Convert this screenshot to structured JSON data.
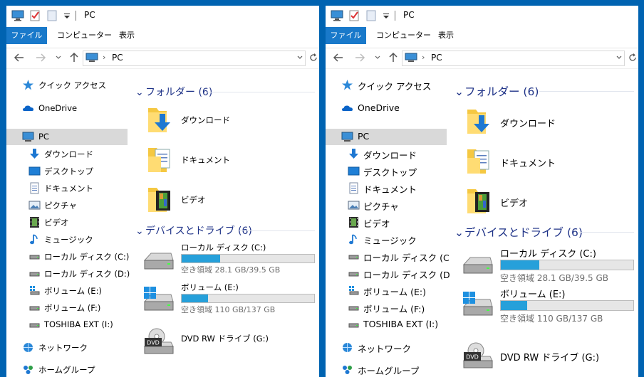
{
  "windows": [
    {
      "title": "PC",
      "ribbon": {
        "file_tab": "ファイル",
        "tabs": [
          "コンピューター",
          "表示"
        ]
      },
      "address": {
        "location": "PC"
      },
      "sidebar": {
        "items": [
          {
            "label": "クイック アクセス",
            "icon": "quick-access-star-icon",
            "level": 1
          },
          {
            "label": "OneDrive",
            "icon": "onedrive-cloud-icon",
            "level": 1
          },
          {
            "label": "PC",
            "icon": "pc-monitor-icon",
            "level": 1,
            "selected": true
          },
          {
            "label": "ダウンロード",
            "icon": "download-arrow-icon",
            "level": 2
          },
          {
            "label": "デスクトップ",
            "icon": "desktop-icon",
            "level": 2
          },
          {
            "label": "ドキュメント",
            "icon": "document-icon",
            "level": 2
          },
          {
            "label": "ピクチャ",
            "icon": "picture-icon",
            "level": 2
          },
          {
            "label": "ビデオ",
            "icon": "video-icon",
            "level": 2
          },
          {
            "label": "ミュージック",
            "icon": "music-note-icon",
            "level": 2
          },
          {
            "label": "ローカル ディスク (C:)",
            "icon": "drive-icon",
            "level": 2
          },
          {
            "label": "ローカル ディスク (D:)",
            "icon": "drive-icon",
            "level": 2
          },
          {
            "label": "ボリューム (E:)",
            "icon": "windows-drive-icon",
            "level": 2
          },
          {
            "label": "ボリューム (F:)",
            "icon": "drive-icon",
            "level": 2
          },
          {
            "label": "TOSHIBA EXT (I:)",
            "icon": "drive-icon",
            "level": 2
          },
          {
            "label": "ネットワーク",
            "icon": "network-icon",
            "level": 1
          },
          {
            "label": "ホームグループ",
            "icon": "homegroup-icon",
            "level": 1
          }
        ]
      },
      "content": {
        "folders_header": "フォルダー (6)",
        "folders": [
          {
            "label": "ダウンロード",
            "icon": "download-folder-icon"
          },
          {
            "label": "ドキュメント",
            "icon": "documents-folder-icon"
          },
          {
            "label": "ビデオ",
            "icon": "video-folder-icon"
          }
        ],
        "devices_header": "デバイスとドライブ (6)",
        "drives": [
          {
            "name": "ローカル ディスク (C:)",
            "space": "空き領域 28.1 GB/39.5 GB",
            "used_fraction": 0.29,
            "icon": "hard-drive-icon"
          },
          {
            "name": "ボリューム (E:)",
            "space": "空き領域 110 GB/137 GB",
            "used_fraction": 0.2,
            "icon": "windows-hard-drive-icon"
          },
          {
            "name": "DVD RW ドライブ (G:)",
            "icon": "dvd-drive-icon"
          }
        ]
      }
    },
    {
      "title": "PC",
      "ribbon": {
        "file_tab": "ファイル",
        "tabs": [
          "コンピューター",
          "表示"
        ]
      },
      "address": {
        "location": "PC"
      },
      "sidebar": {
        "items": [
          {
            "label": "クイック アクセス",
            "icon": "quick-access-star-icon",
            "level": 1
          },
          {
            "label": "OneDrive",
            "icon": "onedrive-cloud-icon",
            "level": 1
          },
          {
            "label": "PC",
            "icon": "pc-monitor-icon",
            "level": 1,
            "selected": true
          },
          {
            "label": "ダウンロード",
            "icon": "download-arrow-icon",
            "level": 2
          },
          {
            "label": "デスクトップ",
            "icon": "desktop-icon",
            "level": 2
          },
          {
            "label": "ドキュメント",
            "icon": "document-icon",
            "level": 2
          },
          {
            "label": "ピクチャ",
            "icon": "picture-icon",
            "level": 2
          },
          {
            "label": "ビデオ",
            "icon": "video-icon",
            "level": 2
          },
          {
            "label": "ミュージック",
            "icon": "music-note-icon",
            "level": 2
          },
          {
            "label": "ローカル ディスク (C",
            "icon": "drive-icon",
            "level": 2
          },
          {
            "label": "ローカル ディスク (D",
            "icon": "drive-icon",
            "level": 2
          },
          {
            "label": "ボリューム (E:)",
            "icon": "windows-drive-icon",
            "level": 2
          },
          {
            "label": "ボリューム (F:)",
            "icon": "drive-icon",
            "level": 2
          },
          {
            "label": "TOSHIBA EXT (I:)",
            "icon": "drive-icon",
            "level": 2
          },
          {
            "label": "ネットワーク",
            "icon": "network-icon",
            "level": 1
          },
          {
            "label": "ホームグループ",
            "icon": "homegroup-icon",
            "level": 1
          }
        ]
      },
      "content": {
        "folders_header": "フォルダー (6)",
        "folders": [
          {
            "label": "ダウンロード",
            "icon": "download-folder-icon"
          },
          {
            "label": "ドキュメント",
            "icon": "documents-folder-icon"
          },
          {
            "label": "ビデオ",
            "icon": "video-folder-icon"
          }
        ],
        "devices_header": "デバイスとドライブ (6)",
        "drives": [
          {
            "name": "ローカル ディスク (C:)",
            "space": "空き領域 28.1 GB/39.5 GB",
            "used_fraction": 0.29,
            "icon": "hard-drive-icon"
          },
          {
            "name": "ボリューム (E:)",
            "space": "空き領域 110 GB/137 GB",
            "used_fraction": 0.2,
            "icon": "windows-hard-drive-icon"
          },
          {
            "name": "DVD RW ドライブ (G:)",
            "icon": "dvd-drive-icon"
          }
        ]
      }
    }
  ]
}
